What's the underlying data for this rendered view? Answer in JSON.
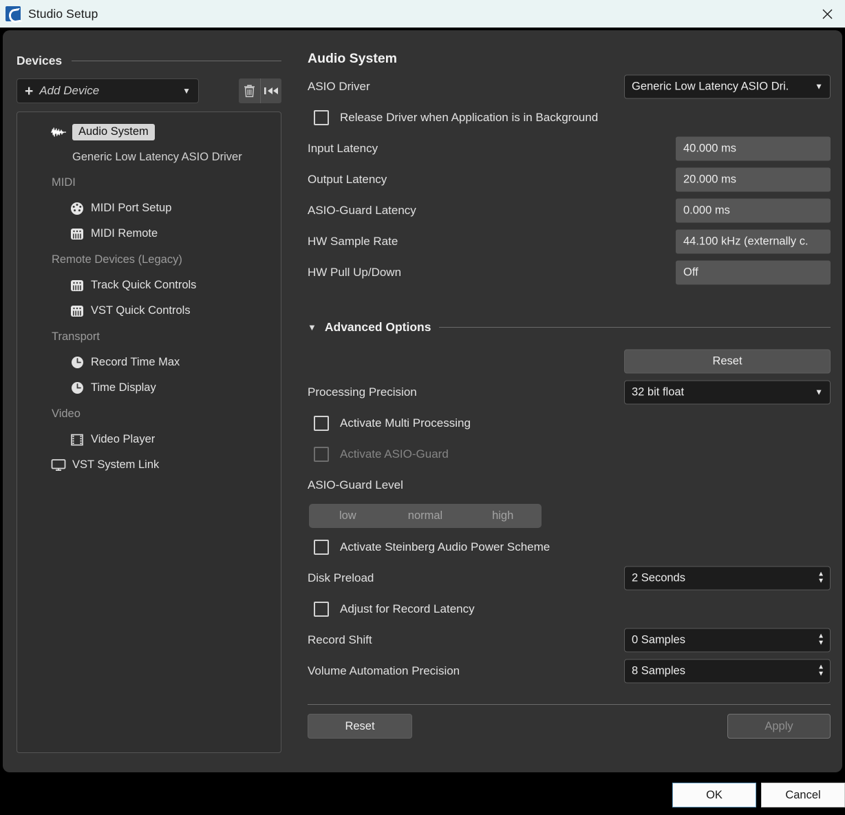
{
  "window": {
    "title": "Studio Setup",
    "app_icon": "cubase-logo-icon",
    "close_icon": "close-icon"
  },
  "sidebar": {
    "section_title": "Devices",
    "add_device": {
      "label": "Add Device",
      "plus_icon": "plus-icon",
      "caret_icon": "chevron-down-icon"
    },
    "toolbar": {
      "delete_icon": "trash-icon",
      "reset_icon": "skip-to-start-icon"
    },
    "tree": [
      {
        "label": "Audio System",
        "icon": "waveform-icon",
        "type": "root",
        "selected": true
      },
      {
        "label": "Generic Low Latency ASIO Driver",
        "icon": "",
        "type": "sub",
        "selected": false
      },
      {
        "label": "MIDI",
        "icon": "",
        "type": "group",
        "selected": false
      },
      {
        "label": "MIDI Port Setup",
        "icon": "midi-port-icon",
        "type": "child",
        "selected": false
      },
      {
        "label": "MIDI Remote",
        "icon": "midi-keyboard-icon",
        "type": "child",
        "selected": false
      },
      {
        "label": "Remote Devices (Legacy)",
        "icon": "",
        "type": "group",
        "selected": false
      },
      {
        "label": "Track Quick Controls",
        "icon": "midi-keyboard-icon",
        "type": "child",
        "selected": false
      },
      {
        "label": "VST Quick Controls",
        "icon": "midi-keyboard-icon",
        "type": "child",
        "selected": false
      },
      {
        "label": "Transport",
        "icon": "",
        "type": "group",
        "selected": false
      },
      {
        "label": "Record Time Max",
        "icon": "clock-icon",
        "type": "child",
        "selected": false
      },
      {
        "label": "Time Display",
        "icon": "clock-icon",
        "type": "child",
        "selected": false
      },
      {
        "label": "Video",
        "icon": "",
        "type": "group",
        "selected": false
      },
      {
        "label": "Video Player",
        "icon": "film-frame-icon",
        "type": "child",
        "selected": false
      },
      {
        "label": "VST System Link",
        "icon": "monitor-icon",
        "type": "root",
        "selected": false
      }
    ]
  },
  "main": {
    "title": "Audio System",
    "asio_driver": {
      "label": "ASIO Driver",
      "value": "Generic Low Latency ASIO Dri.",
      "caret_icon": "chevron-down-icon"
    },
    "release_driver": {
      "label": "Release Driver when Application is in Background",
      "checked": false
    },
    "readonly_fields": [
      {
        "label": "Input Latency",
        "value": "40.000 ms"
      },
      {
        "label": "Output Latency",
        "value": "20.000 ms"
      },
      {
        "label": "ASIO-Guard Latency",
        "value": "0.000 ms"
      },
      {
        "label": "HW Sample Rate",
        "value": "44.100 kHz (externally c."
      },
      {
        "label": "HW Pull Up/Down",
        "value": "Off"
      }
    ],
    "advanced": {
      "header": "Advanced Options",
      "triangle_icon": "triangle-down-icon",
      "reset_label": "Reset",
      "processing_precision": {
        "label": "Processing Precision",
        "value": "32 bit float",
        "caret_icon": "chevron-down-icon"
      },
      "multi_processing": {
        "label": "Activate Multi Processing",
        "checked": false,
        "disabled": false
      },
      "asio_guard": {
        "label": "Activate ASIO-Guard",
        "checked": false,
        "disabled": true
      },
      "asio_guard_level": {
        "label": "ASIO-Guard Level",
        "options": [
          "low",
          "normal",
          "high"
        ],
        "selected": ""
      },
      "power_scheme": {
        "label": "Activate Steinberg Audio Power Scheme",
        "checked": false
      },
      "disk_preload": {
        "label": "Disk Preload",
        "value": "2 Seconds",
        "up_icon": "spinner-up-icon",
        "down_icon": "spinner-down-icon"
      },
      "adjust_record_latency": {
        "label": "Adjust for Record Latency",
        "checked": false
      },
      "record_shift": {
        "label": "Record Shift",
        "value": "0 Samples",
        "up_icon": "spinner-up-icon",
        "down_icon": "spinner-down-icon"
      },
      "volume_automation_precision": {
        "label": "Volume Automation Precision",
        "value": "8 Samples",
        "up_icon": "spinner-up-icon",
        "down_icon": "spinner-down-icon"
      },
      "footer": {
        "reset_label": "Reset",
        "apply_label": "Apply",
        "apply_disabled": true
      }
    }
  },
  "bottom_bar": {
    "ok_label": "OK",
    "cancel_label": "Cancel"
  },
  "colors": {
    "titlebar_bg": "#eaf4f4",
    "dialog_bg": "#333333",
    "panel_bg": "#2f2f2f",
    "accent_ok_border": "#6aa2c8",
    "field_bg": "#565656",
    "combo_bg": "#1c1c1c"
  }
}
